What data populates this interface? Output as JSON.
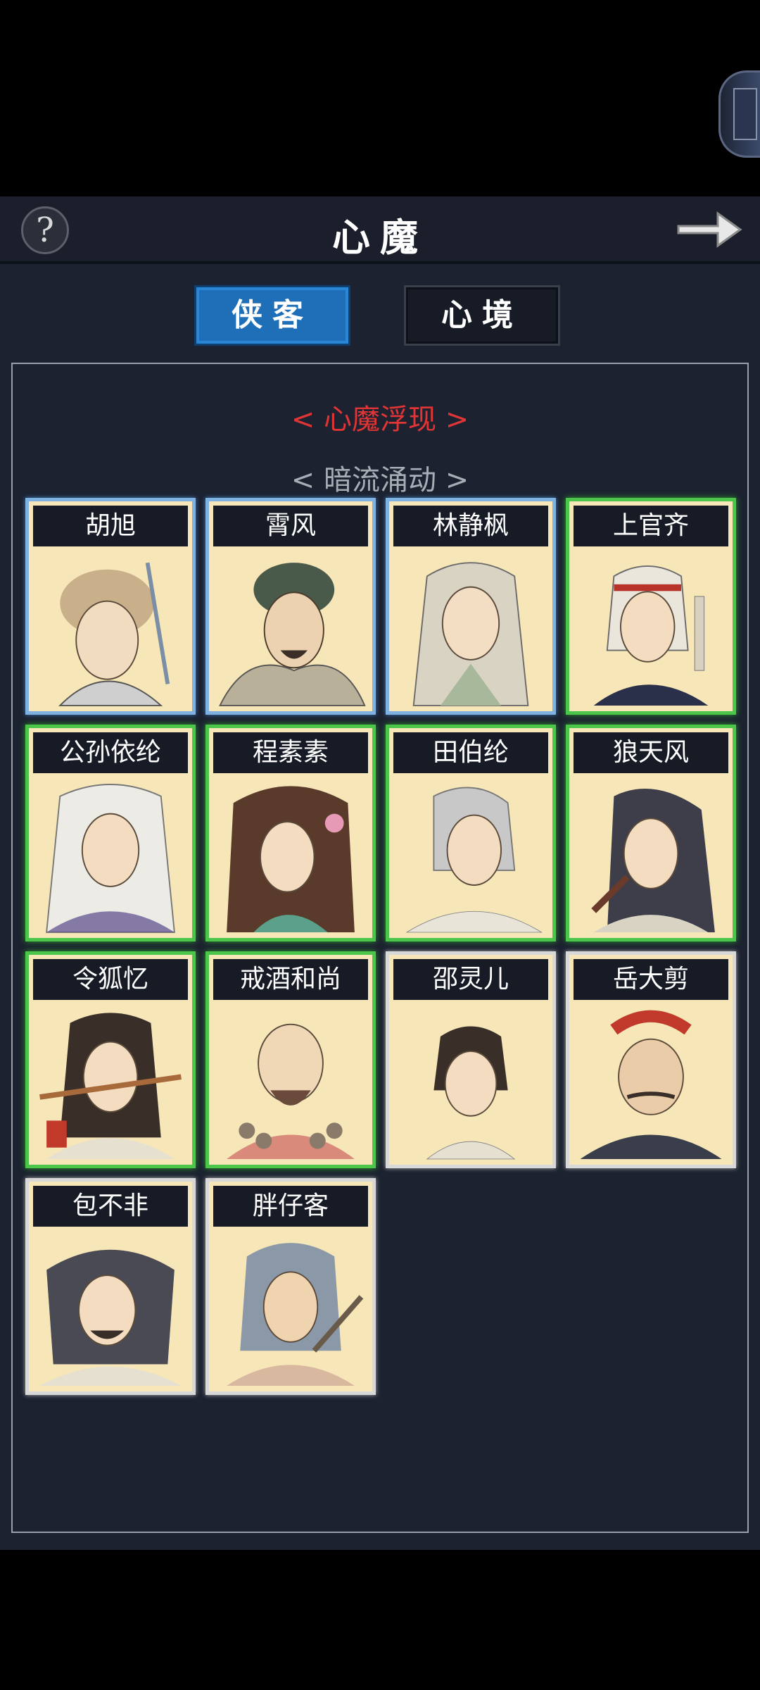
{
  "header": {
    "title": "心魔",
    "help_icon": "question-icon",
    "next_icon": "arrow-right-icon"
  },
  "tabs": [
    {
      "label": "侠客",
      "active": true
    },
    {
      "label": "心境",
      "active": false
    }
  ],
  "content": {
    "section_title": "< 心魔浮现 >",
    "subsection_title": "< 暗流涌动 >",
    "characters": [
      {
        "name": "胡旭",
        "frame": "blue"
      },
      {
        "name": "霄风",
        "frame": "blue"
      },
      {
        "name": "林静枫",
        "frame": "blue"
      },
      {
        "name": "上官齐",
        "frame": "green"
      },
      {
        "name": "公孙依纶",
        "frame": "green"
      },
      {
        "name": "程素素",
        "frame": "green"
      },
      {
        "name": "田伯纶",
        "frame": "green"
      },
      {
        "name": "狼天风",
        "frame": "green"
      },
      {
        "name": "令狐忆",
        "frame": "green"
      },
      {
        "name": "戒酒和尚",
        "frame": "green"
      },
      {
        "name": "邵灵儿",
        "frame": "white"
      },
      {
        "name": "岳大剪",
        "frame": "white"
      },
      {
        "name": "包不非",
        "frame": "white"
      },
      {
        "name": "胖仔客",
        "frame": "white"
      }
    ]
  },
  "colors": {
    "blue_frame": "#7fb2e0",
    "green_frame": "#4bc64b",
    "white_frame": "#d8d8d8",
    "tab_active": "#1e6fb8",
    "section_red": "#e03535"
  }
}
